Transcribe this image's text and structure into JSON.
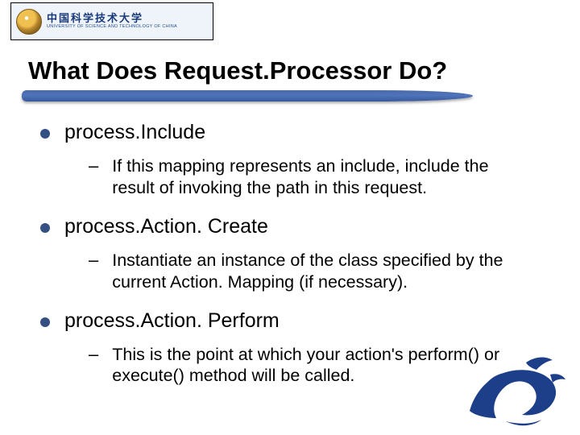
{
  "logo": {
    "cn": "中国科学技术大学",
    "en": "UNIVERSITY OF SCIENCE AND TECHNOLOGY OF CHINA"
  },
  "title": "What Does Request.Processor Do?",
  "items": [
    {
      "label": "process.Include",
      "sub": "If this mapping represents an include, include the result of invoking the path in this request."
    },
    {
      "label": "process.Action. Create",
      "sub": "Instantiate an instance of the class specified by the current Action. Mapping (if necessary)."
    },
    {
      "label": "process.Action. Perform",
      "sub": "This is the point at which your action's perform() or execute() method will be called."
    }
  ],
  "icons": {
    "bullet": "disc",
    "subbullet": "–",
    "corner": "dragon"
  }
}
